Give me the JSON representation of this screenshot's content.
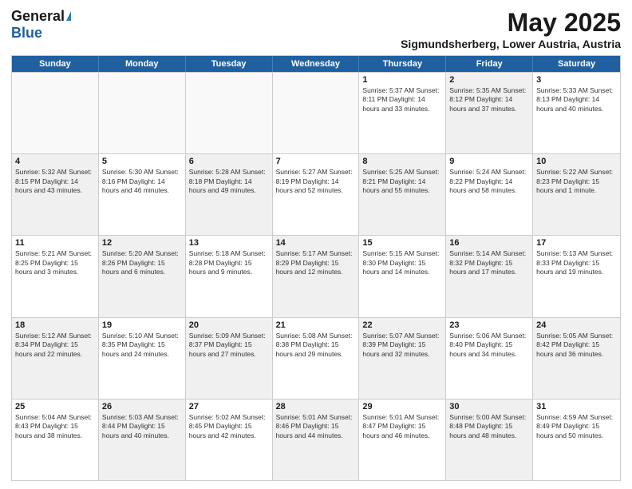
{
  "header": {
    "logo_general": "General",
    "logo_blue": "Blue",
    "title": "May 2025",
    "location": "Sigmundsherberg, Lower Austria, Austria"
  },
  "calendar": {
    "days_of_week": [
      "Sunday",
      "Monday",
      "Tuesday",
      "Wednesday",
      "Thursday",
      "Friday",
      "Saturday"
    ],
    "rows": [
      [
        {
          "day": "",
          "info": "",
          "empty": true
        },
        {
          "day": "",
          "info": "",
          "empty": true
        },
        {
          "day": "",
          "info": "",
          "empty": true
        },
        {
          "day": "",
          "info": "",
          "empty": true
        },
        {
          "day": "1",
          "info": "Sunrise: 5:37 AM\nSunset: 8:11 PM\nDaylight: 14 hours\nand 33 minutes."
        },
        {
          "day": "2",
          "info": "Sunrise: 5:35 AM\nSunset: 8:12 PM\nDaylight: 14 hours\nand 37 minutes.",
          "shaded": true
        },
        {
          "day": "3",
          "info": "Sunrise: 5:33 AM\nSunset: 8:13 PM\nDaylight: 14 hours\nand 40 minutes."
        }
      ],
      [
        {
          "day": "4",
          "info": "Sunrise: 5:32 AM\nSunset: 8:15 PM\nDaylight: 14 hours\nand 43 minutes.",
          "shaded": true
        },
        {
          "day": "5",
          "info": "Sunrise: 5:30 AM\nSunset: 8:16 PM\nDaylight: 14 hours\nand 46 minutes."
        },
        {
          "day": "6",
          "info": "Sunrise: 5:28 AM\nSunset: 8:18 PM\nDaylight: 14 hours\nand 49 minutes.",
          "shaded": true
        },
        {
          "day": "7",
          "info": "Sunrise: 5:27 AM\nSunset: 8:19 PM\nDaylight: 14 hours\nand 52 minutes."
        },
        {
          "day": "8",
          "info": "Sunrise: 5:25 AM\nSunset: 8:21 PM\nDaylight: 14 hours\nand 55 minutes.",
          "shaded": true
        },
        {
          "day": "9",
          "info": "Sunrise: 5:24 AM\nSunset: 8:22 PM\nDaylight: 14 hours\nand 58 minutes."
        },
        {
          "day": "10",
          "info": "Sunrise: 5:22 AM\nSunset: 8:23 PM\nDaylight: 15 hours\nand 1 minute.",
          "shaded": true
        }
      ],
      [
        {
          "day": "11",
          "info": "Sunrise: 5:21 AM\nSunset: 8:25 PM\nDaylight: 15 hours\nand 3 minutes."
        },
        {
          "day": "12",
          "info": "Sunrise: 5:20 AM\nSunset: 8:26 PM\nDaylight: 15 hours\nand 6 minutes.",
          "shaded": true
        },
        {
          "day": "13",
          "info": "Sunrise: 5:18 AM\nSunset: 8:28 PM\nDaylight: 15 hours\nand 9 minutes."
        },
        {
          "day": "14",
          "info": "Sunrise: 5:17 AM\nSunset: 8:29 PM\nDaylight: 15 hours\nand 12 minutes.",
          "shaded": true
        },
        {
          "day": "15",
          "info": "Sunrise: 5:15 AM\nSunset: 8:30 PM\nDaylight: 15 hours\nand 14 minutes."
        },
        {
          "day": "16",
          "info": "Sunrise: 5:14 AM\nSunset: 8:32 PM\nDaylight: 15 hours\nand 17 minutes.",
          "shaded": true
        },
        {
          "day": "17",
          "info": "Sunrise: 5:13 AM\nSunset: 8:33 PM\nDaylight: 15 hours\nand 19 minutes."
        }
      ],
      [
        {
          "day": "18",
          "info": "Sunrise: 5:12 AM\nSunset: 8:34 PM\nDaylight: 15 hours\nand 22 minutes.",
          "shaded": true
        },
        {
          "day": "19",
          "info": "Sunrise: 5:10 AM\nSunset: 8:35 PM\nDaylight: 15 hours\nand 24 minutes."
        },
        {
          "day": "20",
          "info": "Sunrise: 5:09 AM\nSunset: 8:37 PM\nDaylight: 15 hours\nand 27 minutes.",
          "shaded": true
        },
        {
          "day": "21",
          "info": "Sunrise: 5:08 AM\nSunset: 8:38 PM\nDaylight: 15 hours\nand 29 minutes."
        },
        {
          "day": "22",
          "info": "Sunrise: 5:07 AM\nSunset: 8:39 PM\nDaylight: 15 hours\nand 32 minutes.",
          "shaded": true
        },
        {
          "day": "23",
          "info": "Sunrise: 5:06 AM\nSunset: 8:40 PM\nDaylight: 15 hours\nand 34 minutes."
        },
        {
          "day": "24",
          "info": "Sunrise: 5:05 AM\nSunset: 8:42 PM\nDaylight: 15 hours\nand 36 minutes.",
          "shaded": true
        }
      ],
      [
        {
          "day": "25",
          "info": "Sunrise: 5:04 AM\nSunset: 8:43 PM\nDaylight: 15 hours\nand 38 minutes."
        },
        {
          "day": "26",
          "info": "Sunrise: 5:03 AM\nSunset: 8:44 PM\nDaylight: 15 hours\nand 40 minutes.",
          "shaded": true
        },
        {
          "day": "27",
          "info": "Sunrise: 5:02 AM\nSunset: 8:45 PM\nDaylight: 15 hours\nand 42 minutes."
        },
        {
          "day": "28",
          "info": "Sunrise: 5:01 AM\nSunset: 8:46 PM\nDaylight: 15 hours\nand 44 minutes.",
          "shaded": true
        },
        {
          "day": "29",
          "info": "Sunrise: 5:01 AM\nSunset: 8:47 PM\nDaylight: 15 hours\nand 46 minutes."
        },
        {
          "day": "30",
          "info": "Sunrise: 5:00 AM\nSunset: 8:48 PM\nDaylight: 15 hours\nand 48 minutes.",
          "shaded": true
        },
        {
          "day": "31",
          "info": "Sunrise: 4:59 AM\nSunset: 8:49 PM\nDaylight: 15 hours\nand 50 minutes."
        }
      ]
    ]
  }
}
